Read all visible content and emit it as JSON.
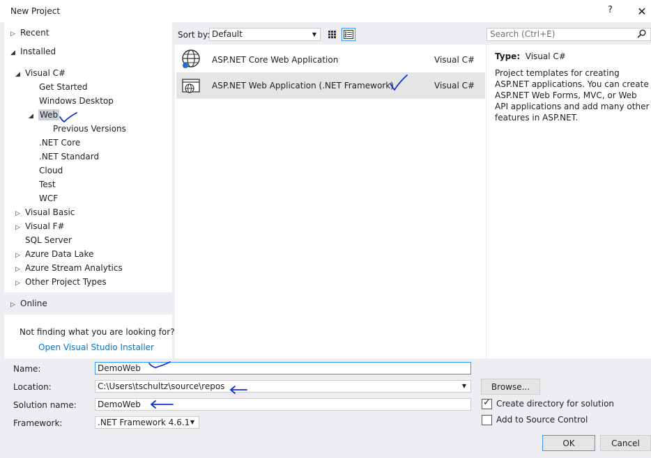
{
  "window": {
    "title": "New Project",
    "help_label": "?",
    "close_label": "✕"
  },
  "tree": {
    "recent": "Recent",
    "installed": "Installed",
    "visual_csharp": "Visual C#",
    "get_started": "Get Started",
    "windows_desktop": "Windows Desktop",
    "web": "Web",
    "previous_versions": "Previous Versions",
    "net_core": ".NET Core",
    "net_standard": ".NET Standard",
    "cloud": "Cloud",
    "test": "Test",
    "wcf": "WCF",
    "visual_basic": "Visual Basic",
    "visual_fsharp": "Visual F#",
    "sql_server": "SQL Server",
    "azure_data_lake": "Azure Data Lake",
    "azure_stream_analytics": "Azure Stream Analytics",
    "other_project_types": "Other Project Types",
    "online": "Online"
  },
  "not_finding": "Not finding what you are looking for?",
  "installer_link": "Open Visual Studio Installer",
  "sort": {
    "label": "Sort by:",
    "value": "Default"
  },
  "search": {
    "placeholder": "Search (Ctrl+E)"
  },
  "templates": [
    {
      "name": "ASP.NET Core Web Application",
      "lang": "Visual C#"
    },
    {
      "name": "ASP.NET Web Application (.NET Framework)",
      "lang": "Visual C#"
    }
  ],
  "details": {
    "type_label": "Type:",
    "type_value": "Visual C#",
    "description": "Project templates for creating ASP.NET applications. You can create ASP.NET Web Forms, MVC, or Web API applications and add many other features in ASP.NET."
  },
  "form": {
    "name_label": "Name:",
    "name_value": "DemoWeb",
    "location_label": "Location:",
    "location_value": "C:\\Users\\tschultz\\source\\repos",
    "solution_label": "Solution name:",
    "solution_value": "DemoWeb",
    "framework_label": "Framework:",
    "framework_value": ".NET Framework 4.6.1"
  },
  "buttons": {
    "browse": "Browse...",
    "ok": "OK",
    "cancel": "Cancel"
  },
  "checkboxes": {
    "create_directory": "Create directory for solution",
    "add_source_control": "Add to Source Control"
  },
  "colors": {
    "accent": "#3399ff",
    "link": "#0e70c0",
    "annotation_ink": "#1030d0",
    "selection": "#ccd0d9"
  }
}
